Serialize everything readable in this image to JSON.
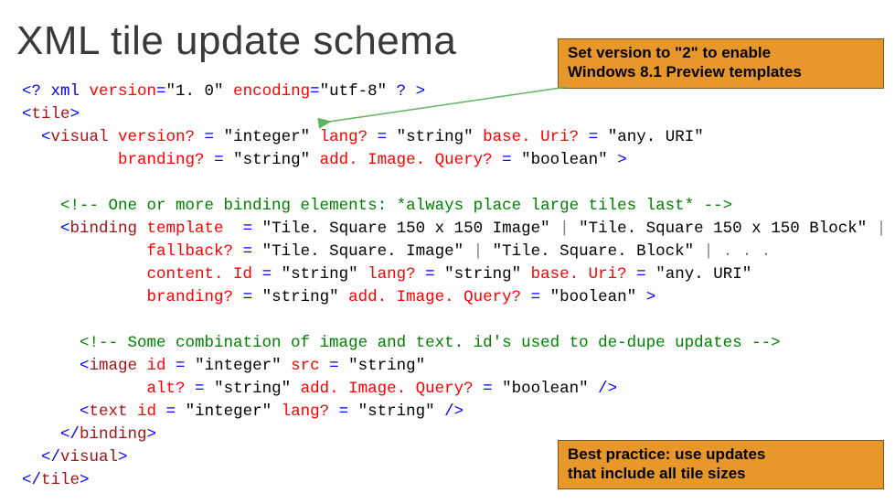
{
  "title": "XML tile update schema",
  "callout_top_line1": "Set version to \"2\" to enable",
  "callout_top_line2": "Windows 8.1 Preview templates",
  "callout_bottom_line1": "Best practice: use updates",
  "callout_bottom_line2": "that include all tile sizes",
  "code": {
    "l01_a": "<? xml ",
    "l01_b": "version",
    "l01_c": "=",
    "l01_d": "\"1. 0\" ",
    "l01_e": "encoding",
    "l01_f": "=",
    "l01_g": "\"utf-8\" ",
    "l01_h": "? >",
    "l02_a": "<",
    "l02_b": "tile",
    "l02_c": ">",
    "l03_a": "  <",
    "l03_b": "visual ",
    "l03_c": "version? ",
    "l03_d": "= ",
    "l03_e": "\"integer\" ",
    "l03_f": "lang? ",
    "l03_g": "= ",
    "l03_h": "\"string\" ",
    "l03_i": "base. Uri? ",
    "l03_j": "= ",
    "l03_k": "\"any. URI\"",
    "l04_a": "          ",
    "l04_b": "branding? ",
    "l04_c": "= ",
    "l04_d": "\"string\" ",
    "l04_e": "add. Image. Query? ",
    "l04_f": "= ",
    "l04_g": "\"boolean\" ",
    "l04_h": ">",
    "l05": "",
    "l06_a": "    ",
    "l06_b": "<!-- One or more binding elements: *always place large tiles last* -->",
    "l07_a": "    <",
    "l07_b": "binding ",
    "l07_c": "template  ",
    "l07_d": "= ",
    "l07_e": "\"Tile. Square 150 x 150 Image\" ",
    "l07_f": "| ",
    "l07_g": "\"Tile. Square 150 x 150 Block\" ",
    "l07_h": "| . . .",
    "l08_a": "             ",
    "l08_b": "fallback? ",
    "l08_c": "= ",
    "l08_d": "\"Tile. Square. Image\" ",
    "l08_e": "| ",
    "l08_f": "\"Tile. Square. Block\" ",
    "l08_g": "| . . .",
    "l09_a": "             ",
    "l09_b": "content. Id ",
    "l09_c": "= ",
    "l09_d": "\"string\" ",
    "l09_e": "lang? ",
    "l09_f": "= ",
    "l09_g": "\"string\" ",
    "l09_h": "base. Uri? ",
    "l09_i": "= ",
    "l09_j": "\"any. URI\"",
    "l10_a": "             ",
    "l10_b": "branding? ",
    "l10_c": "= ",
    "l10_d": "\"string\" ",
    "l10_e": "add. Image. Query? ",
    "l10_f": "= ",
    "l10_g": "\"boolean\" ",
    "l10_h": ">",
    "l11": "",
    "l12_a": "      ",
    "l12_b": "<!-- Some combination of image and text. id's used to de-dupe updates -->",
    "l13_a": "      <",
    "l13_b": "image ",
    "l13_c": "id ",
    "l13_d": "= ",
    "l13_e": "\"integer\" ",
    "l13_f": "src ",
    "l13_g": "= ",
    "l13_h": "\"string\"",
    "l14_a": "             ",
    "l14_b": "alt? ",
    "l14_c": "= ",
    "l14_d": "\"string\" ",
    "l14_e": "add. Image. Query? ",
    "l14_f": "= ",
    "l14_g": "\"boolean\" ",
    "l14_h": "/>",
    "l15_a": "      <",
    "l15_b": "text ",
    "l15_c": "id ",
    "l15_d": "= ",
    "l15_e": "\"integer\" ",
    "l15_f": "lang? ",
    "l15_g": "= ",
    "l15_h": "\"string\" ",
    "l15_i": "/>",
    "l16_a": "    </",
    "l16_b": "binding",
    "l16_c": ">",
    "l17_a": "  </",
    "l17_b": "visual",
    "l17_c": ">",
    "l18_a": "</",
    "l18_b": "tile",
    "l18_c": ">"
  }
}
